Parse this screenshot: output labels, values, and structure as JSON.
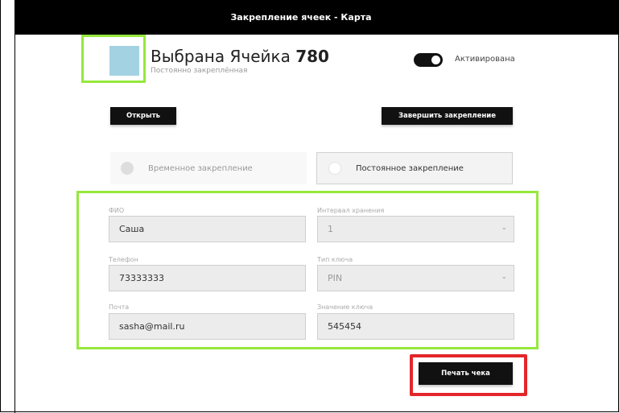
{
  "window": {
    "title": "Закрепление ячеек - Карта"
  },
  "cell": {
    "title_prefix": "Выбрана Ячейка",
    "number": "780",
    "subtitle": "Постоянно закреплённая",
    "swatch_color": "#a3d2e2"
  },
  "activation": {
    "label": "Активирована",
    "on": true
  },
  "actions": {
    "open_label": "Открыть",
    "finish_label": "Завершить закрепление",
    "print_label": "Печать чека"
  },
  "mode": {
    "temporary_label": "Временное закрепление",
    "permanent_label": "Постоянное закрепление",
    "selected": "permanent"
  },
  "form": {
    "fio": {
      "label": "ФИО",
      "value": "Саша"
    },
    "interval": {
      "label": "Интервал хранения",
      "value": "1"
    },
    "phone": {
      "label": "Телефон",
      "value": "73333333"
    },
    "key_type": {
      "label": "Тип ключа",
      "value": "PIN"
    },
    "email": {
      "label": "Почта",
      "value": "sasha@mail.ru"
    },
    "key_value": {
      "label": "Значение ключа",
      "value": "545454"
    }
  },
  "highlight_colors": {
    "green": "#96e83c",
    "red": "#e3262a"
  }
}
